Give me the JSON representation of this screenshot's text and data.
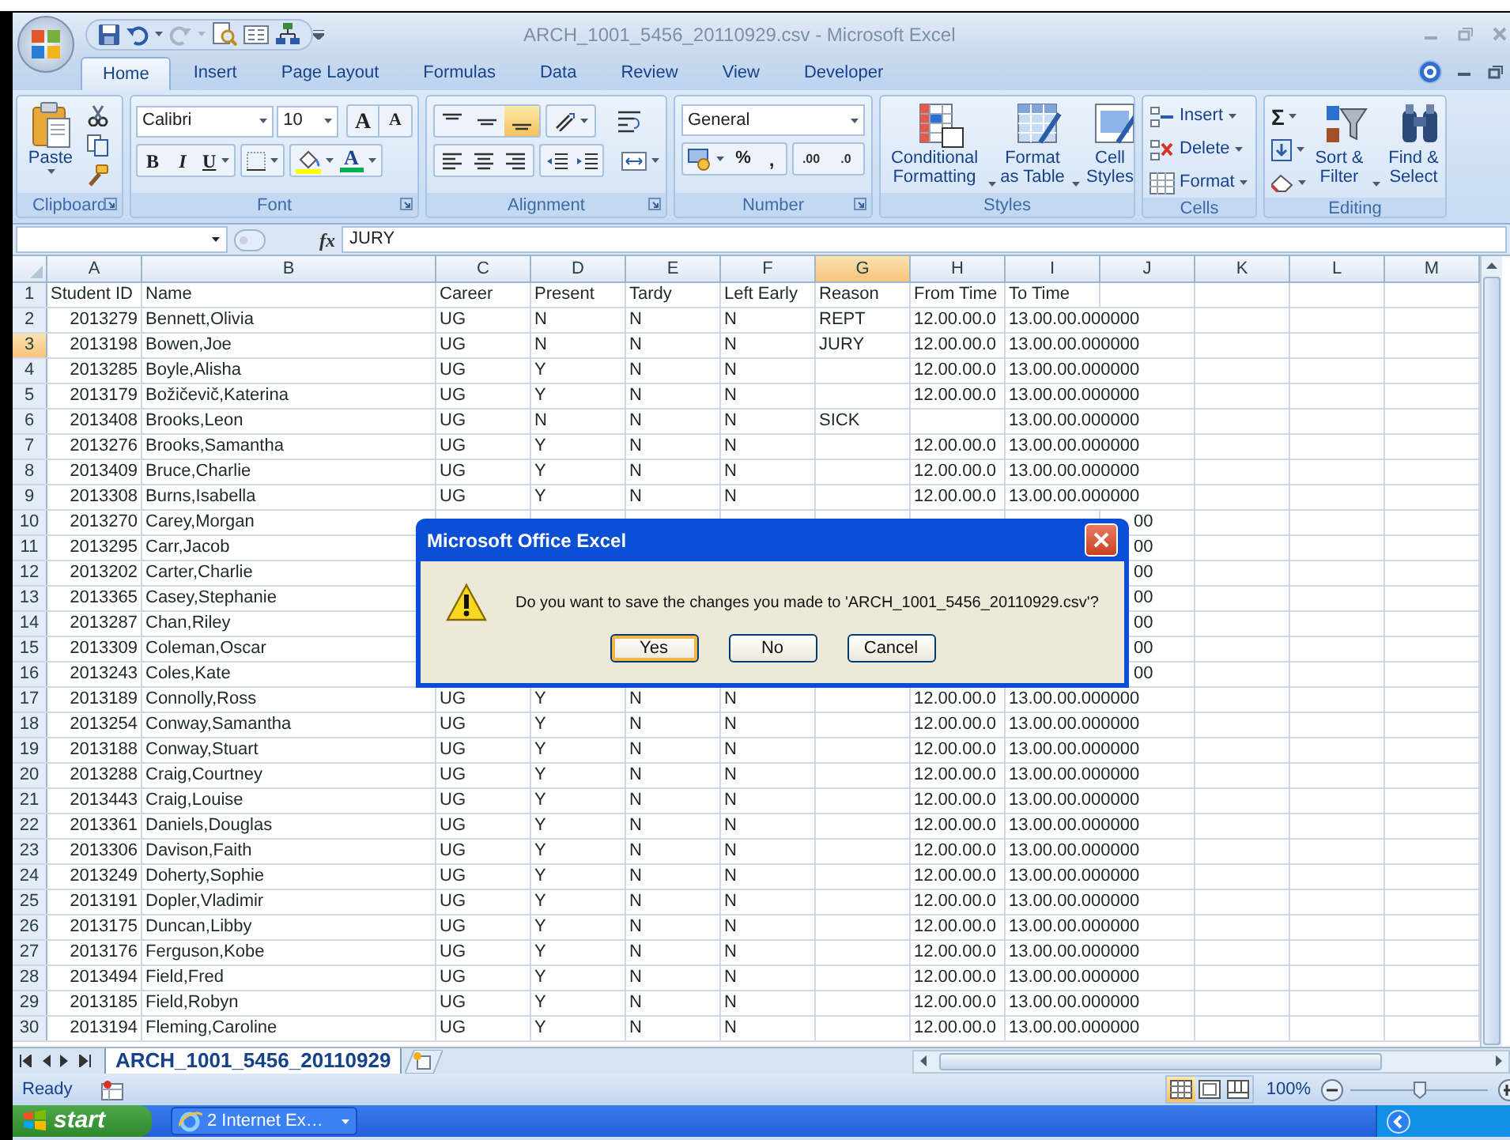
{
  "window": {
    "title": "ARCH_1001_5456_20110929.csv - Microsoft Excel"
  },
  "ribbon_tabs": [
    {
      "label": "Home",
      "selected": true
    },
    {
      "label": "Insert",
      "selected": false
    },
    {
      "label": "Page Layout",
      "selected": false
    },
    {
      "label": "Formulas",
      "selected": false
    },
    {
      "label": "Data",
      "selected": false
    },
    {
      "label": "Review",
      "selected": false
    },
    {
      "label": "View",
      "selected": false
    },
    {
      "label": "Developer",
      "selected": false
    }
  ],
  "ribbon": {
    "clipboard": {
      "paste": "Paste",
      "label": "Clipboard"
    },
    "font": {
      "name": "Calibri",
      "size": "10",
      "grow": "A",
      "shrink": "A",
      "bold": "B",
      "italic": "I",
      "underline": "U",
      "font_color": "A",
      "label": "Font"
    },
    "alignment": {
      "vertical_buttons": [
        {
          "selected": false
        },
        {
          "selected": false
        },
        {
          "selected": true
        }
      ],
      "label": "Alignment"
    },
    "number": {
      "format": "General",
      "percent": "%",
      "comma": ",",
      "increase_decimal": ".00",
      "decrease_decimal": ".0",
      "label": "Number"
    },
    "styles": {
      "conditional": "Conditional Formatting",
      "format_table": "Format as Table",
      "cell_styles": "Cell Styles",
      "label": "Styles"
    },
    "cells": {
      "insert": "Insert",
      "delete": "Delete",
      "format": "Format",
      "label": "Cells"
    },
    "editing": {
      "autosum": "Σ",
      "sort": "Sort & Filter",
      "find": "Find & Select",
      "label": "Editing"
    }
  },
  "formula_bar": {
    "function_label": "fx",
    "value": "JURY"
  },
  "columns": [
    {
      "label": "A",
      "selected": false
    },
    {
      "label": "B",
      "selected": false
    },
    {
      "label": "C",
      "selected": false
    },
    {
      "label": "D",
      "selected": false
    },
    {
      "label": "E",
      "selected": false
    },
    {
      "label": "F",
      "selected": false
    },
    {
      "label": "G",
      "selected": true
    },
    {
      "label": "H",
      "selected": false
    },
    {
      "label": "I",
      "selected": false
    },
    {
      "label": "J",
      "selected": false
    },
    {
      "label": "K",
      "selected": false
    },
    {
      "label": "L",
      "selected": false
    },
    {
      "label": "M",
      "selected": false
    }
  ],
  "rows": [
    {
      "number": "1",
      "selected": false,
      "cells": {
        "A": "Student ID",
        "B": "Name",
        "C": "Career",
        "D": "Present",
        "E": "Tardy",
        "F": "Left Early",
        "G": "Reason",
        "H": "From Time",
        "I": "To Time"
      }
    },
    {
      "number": "2",
      "selected": false,
      "cells": {
        "A": "2013279",
        "B": "Bennett,Olivia",
        "C": "UG",
        "D": "N",
        "E": "N",
        "F": "N",
        "G": "REPT",
        "H": "12.00.00.0",
        "I": "13.00.00.000000"
      }
    },
    {
      "number": "3",
      "selected": true,
      "cells": {
        "A": "2013198",
        "B": "Bowen,Joe",
        "C": "UG",
        "D": "N",
        "E": "N",
        "F": "N",
        "G": "JURY",
        "H": "12.00.00.0",
        "I": "13.00.00.000000"
      }
    },
    {
      "number": "4",
      "selected": false,
      "cells": {
        "A": "2013285",
        "B": "Boyle,Alisha",
        "C": "UG",
        "D": "Y",
        "E": "N",
        "F": "N",
        "H": "12.00.00.0",
        "I": "13.00.00.000000"
      }
    },
    {
      "number": "5",
      "selected": false,
      "cells": {
        "A": "2013179",
        "B": "Božičevič,Katerina",
        "C": "UG",
        "D": "Y",
        "E": "N",
        "F": "N",
        "H": "12.00.00.0",
        "I": "13.00.00.000000"
      }
    },
    {
      "number": "6",
      "selected": false,
      "cells": {
        "A": "2013408",
        "B": "Brooks,Leon",
        "C": "UG",
        "D": "N",
        "E": "N",
        "F": "N",
        "G": "SICK",
        "I": "13.00.00.000000"
      }
    },
    {
      "number": "7",
      "selected": false,
      "cells": {
        "A": "2013276",
        "B": "Brooks,Samantha",
        "C": "UG",
        "D": "Y",
        "E": "N",
        "F": "N",
        "H": "12.00.00.0",
        "I": "13.00.00.000000"
      }
    },
    {
      "number": "8",
      "selected": false,
      "cells": {
        "A": "2013409",
        "B": "Bruce,Charlie",
        "C": "UG",
        "D": "Y",
        "E": "N",
        "F": "N",
        "H": "12.00.00.0",
        "I": "13.00.00.000000"
      }
    },
    {
      "number": "9",
      "selected": false,
      "cells": {
        "A": "2013308",
        "B": "Burns,Isabella",
        "C": "UG",
        "D": "Y",
        "E": "N",
        "F": "N",
        "H": "12.00.00.0",
        "I": "13.00.00.000000"
      }
    },
    {
      "number": "10",
      "selected": false,
      "cells": {
        "A": "2013270",
        "B": "Carey,Morgan",
        "J": "00"
      }
    },
    {
      "number": "11",
      "selected": false,
      "cells": {
        "A": "2013295",
        "B": "Carr,Jacob",
        "J": "00"
      }
    },
    {
      "number": "12",
      "selected": false,
      "cells": {
        "A": "2013202",
        "B": "Carter,Charlie",
        "J": "00"
      }
    },
    {
      "number": "13",
      "selected": false,
      "cells": {
        "A": "2013365",
        "B": "Casey,Stephanie",
        "J": "00"
      }
    },
    {
      "number": "14",
      "selected": false,
      "cells": {
        "A": "2013287",
        "B": "Chan,Riley",
        "J": "00"
      }
    },
    {
      "number": "15",
      "selected": false,
      "cells": {
        "A": "2013309",
        "B": "Coleman,Oscar",
        "J": "00"
      }
    },
    {
      "number": "16",
      "selected": false,
      "cells": {
        "A": "2013243",
        "B": "Coles,Kate",
        "J": "00"
      }
    },
    {
      "number": "17",
      "selected": false,
      "cells": {
        "A": "2013189",
        "B": "Connolly,Ross",
        "C": "UG",
        "D": "Y",
        "E": "N",
        "F": "N",
        "H": "12.00.00.0",
        "I": "13.00.00.000000"
      }
    },
    {
      "number": "18",
      "selected": false,
      "cells": {
        "A": "2013254",
        "B": "Conway,Samantha",
        "C": "UG",
        "D": "Y",
        "E": "N",
        "F": "N",
        "H": "12.00.00.0",
        "I": "13.00.00.000000"
      }
    },
    {
      "number": "19",
      "selected": false,
      "cells": {
        "A": "2013188",
        "B": "Conway,Stuart",
        "C": "UG",
        "D": "Y",
        "E": "N",
        "F": "N",
        "H": "12.00.00.0",
        "I": "13.00.00.000000"
      }
    },
    {
      "number": "20",
      "selected": false,
      "cells": {
        "A": "2013288",
        "B": "Craig,Courtney",
        "C": "UG",
        "D": "Y",
        "E": "N",
        "F": "N",
        "H": "12.00.00.0",
        "I": "13.00.00.000000"
      }
    },
    {
      "number": "21",
      "selected": false,
      "cells": {
        "A": "2013443",
        "B": "Craig,Louise",
        "C": "UG",
        "D": "Y",
        "E": "N",
        "F": "N",
        "H": "12.00.00.0",
        "I": "13.00.00.000000"
      }
    },
    {
      "number": "22",
      "selected": false,
      "cells": {
        "A": "2013361",
        "B": "Daniels,Douglas",
        "C": "UG",
        "D": "Y",
        "E": "N",
        "F": "N",
        "H": "12.00.00.0",
        "I": "13.00.00.000000"
      }
    },
    {
      "number": "23",
      "selected": false,
      "cells": {
        "A": "2013306",
        "B": "Davison,Faith",
        "C": "UG",
        "D": "Y",
        "E": "N",
        "F": "N",
        "H": "12.00.00.0",
        "I": "13.00.00.000000"
      }
    },
    {
      "number": "24",
      "selected": false,
      "cells": {
        "A": "2013249",
        "B": "Doherty,Sophie",
        "C": "UG",
        "D": "Y",
        "E": "N",
        "F": "N",
        "H": "12.00.00.0",
        "I": "13.00.00.000000"
      }
    },
    {
      "number": "25",
      "selected": false,
      "cells": {
        "A": "2013191",
        "B": "Dopler,Vladimir",
        "C": "UG",
        "D": "Y",
        "E": "N",
        "F": "N",
        "H": "12.00.00.0",
        "I": "13.00.00.000000"
      }
    },
    {
      "number": "26",
      "selected": false,
      "cells": {
        "A": "2013175",
        "B": "Duncan,Libby",
        "C": "UG",
        "D": "Y",
        "E": "N",
        "F": "N",
        "H": "12.00.00.0",
        "I": "13.00.00.000000"
      }
    },
    {
      "number": "27",
      "selected": false,
      "cells": {
        "A": "2013176",
        "B": "Ferguson,Kobe",
        "C": "UG",
        "D": "Y",
        "E": "N",
        "F": "N",
        "H": "12.00.00.0",
        "I": "13.00.00.000000"
      }
    },
    {
      "number": "28",
      "selected": false,
      "cells": {
        "A": "2013494",
        "B": "Field,Fred",
        "C": "UG",
        "D": "Y",
        "E": "N",
        "F": "N",
        "H": "12.00.00.0",
        "I": "13.00.00.000000"
      }
    },
    {
      "number": "29",
      "selected": false,
      "cells": {
        "A": "2013185",
        "B": "Field,Robyn",
        "C": "UG",
        "D": "Y",
        "E": "N",
        "F": "N",
        "H": "12.00.00.0",
        "I": "13.00.00.000000"
      }
    },
    {
      "number": "30",
      "selected": false,
      "cells": {
        "A": "2013194",
        "B": "Fleming,Caroline",
        "C": "UG",
        "D": "Y",
        "E": "N",
        "F": "N",
        "H": "12.00.00.0",
        "I": "13.00.00.000000"
      }
    }
  ],
  "sheet_tabs": [
    {
      "label": "ARCH_1001_5456_20110929",
      "selected": true
    }
  ],
  "status_bar": {
    "status": "Ready",
    "view_buttons": [
      {
        "selected": true
      },
      {
        "selected": false
      },
      {
        "selected": false
      }
    ],
    "zoom": "100%",
    "zoom_slider": {
      "level": 0.5
    }
  },
  "dialog": {
    "title": "Microsoft Office Excel",
    "message": "Do you want to save the changes you made to 'ARCH_1001_5456_20110929.csv'?",
    "buttons": [
      {
        "label": "Yes",
        "focused": true
      },
      {
        "label": "No",
        "focused": false
      },
      {
        "label": "Cancel",
        "focused": false
      }
    ]
  },
  "taskbar": {
    "start": "start",
    "tasks": [
      {
        "label": "2 Internet Ex…"
      }
    ]
  }
}
